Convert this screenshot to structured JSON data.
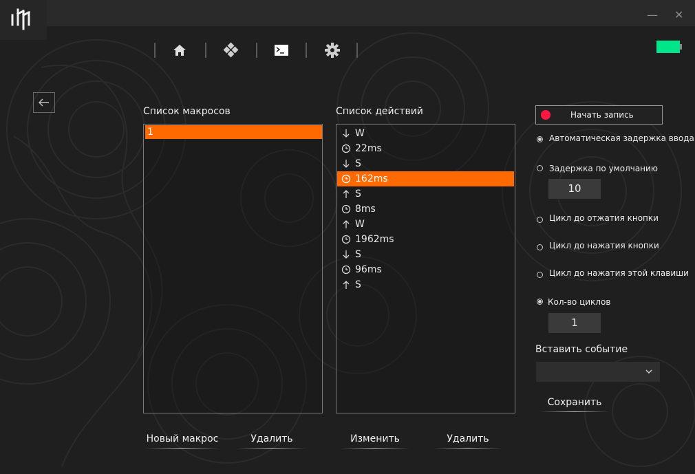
{
  "window": {
    "minimize_glyph": "—",
    "close_glyph": "✕"
  },
  "nav": {
    "icons": [
      "home-icon",
      "diamond-icon",
      "terminal-icon",
      "gear-icon"
    ]
  },
  "battery": {
    "color": "#00e58a"
  },
  "macros": {
    "title": "Список макросов",
    "items": [
      "1"
    ],
    "selected_index": 0
  },
  "actions": {
    "title": "Список действий",
    "items": [
      {
        "icon": "arrow-down",
        "text": "W"
      },
      {
        "icon": "clock",
        "text": "22ms"
      },
      {
        "icon": "arrow-down",
        "text": "S"
      },
      {
        "icon": "clock",
        "text": "162ms"
      },
      {
        "icon": "arrow-up",
        "text": "S"
      },
      {
        "icon": "clock",
        "text": "8ms"
      },
      {
        "icon": "arrow-up",
        "text": "W"
      },
      {
        "icon": "clock",
        "text": "1962ms"
      },
      {
        "icon": "arrow-down",
        "text": "S"
      },
      {
        "icon": "clock",
        "text": "96ms"
      },
      {
        "icon": "arrow-up",
        "text": "S"
      }
    ],
    "selected_index": 3
  },
  "record": {
    "label": "Начать запись",
    "dot_color": "#ff1744"
  },
  "options": {
    "auto_delay": "Автоматическая задержка ввода",
    "default_delay": "Задержка по умолчанию",
    "default_delay_value": "10",
    "loop_release": "Цикл до отжатия кнопки",
    "loop_press": "Цикл до нажатия кнопки",
    "loop_this_key": "Цикл до нажатия этой клавиши",
    "cycle_count": "Кол-во циклов",
    "cycle_count_value": "1",
    "delay_selected": "auto_delay",
    "loop_selected": "cycle_count"
  },
  "insert_event": {
    "label": "Вставить событие",
    "value": ""
  },
  "buttons": {
    "save": "Сохранить",
    "new_macro": "Новый макрос",
    "delete_macro": "Удалить",
    "edit_action": "Изменить",
    "delete_action": "Удалить"
  },
  "colors": {
    "accent": "#ff6a00",
    "background": "#1f1f1f"
  }
}
